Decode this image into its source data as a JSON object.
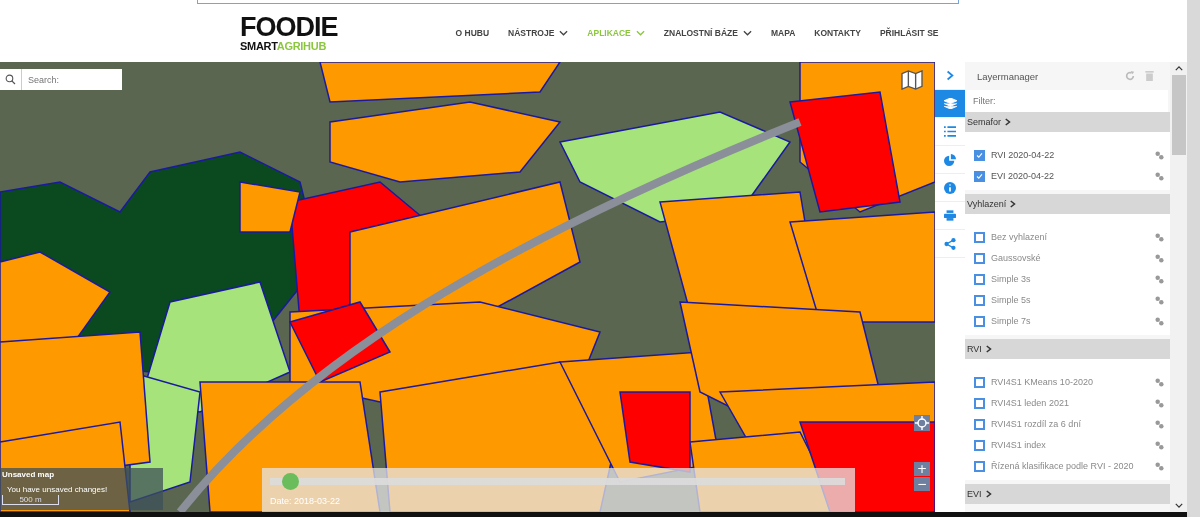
{
  "header": {
    "logo": {
      "word": "FOODIE",
      "sub_dark": "SMART",
      "sub_green": "AGRIHUB"
    },
    "nav": [
      {
        "label": "O HUBU",
        "selected": false,
        "dropdown": false
      },
      {
        "label": "NÁSTROJE",
        "selected": false,
        "dropdown": true
      },
      {
        "label": "APLIKACE",
        "selected": true,
        "dropdown": true
      },
      {
        "label": "ZNALOSTNÍ BÁZE",
        "selected": false,
        "dropdown": true
      },
      {
        "label": "MAPA",
        "selected": false,
        "dropdown": false
      },
      {
        "label": "KONTAKTY",
        "selected": false,
        "dropdown": false
      },
      {
        "label": "PŘIHLÁSIT SE",
        "selected": false,
        "dropdown": false
      }
    ]
  },
  "map": {
    "search": {
      "placeholder": "Search:"
    },
    "notice": {
      "title": "Unsaved map",
      "message": "You have unsaved changes!"
    },
    "scale": "500 m",
    "time_slider": {
      "level": 0.02,
      "label": "Date: 2018-03-22"
    },
    "zoom": [
      "+",
      "−"
    ]
  },
  "toolbar": [
    {
      "kind": "collapse",
      "selected": false
    },
    {
      "kind": "layers",
      "selected": true
    },
    {
      "kind": "legend",
      "selected": false
    },
    {
      "kind": "chart",
      "selected": false
    },
    {
      "kind": "info",
      "selected": false
    },
    {
      "kind": "print",
      "selected": false
    },
    {
      "kind": "share",
      "selected": false
    }
  ],
  "layer_manager": {
    "title": "Layermanager",
    "filter": {
      "placeholder": "Filter:"
    },
    "groups": [
      {
        "name": "Semafor",
        "layers": [
          {
            "name": "RVI 2020-04-22",
            "checked": true
          },
          {
            "name": "EVI 2020-04-22",
            "checked": true
          }
        ]
      },
      {
        "name": "Vyhlazení",
        "layers": [
          {
            "name": "Bez vyhlazení",
            "checked": false
          },
          {
            "name": "Gaussovské",
            "checked": false
          },
          {
            "name": "Simple 3s",
            "checked": false
          },
          {
            "name": "Simple 5s",
            "checked": false
          },
          {
            "name": "Simple 7s",
            "checked": false
          }
        ]
      },
      {
        "name": "RVI",
        "layers": [
          {
            "name": "RVI4S1 KMeans 10-2020",
            "checked": false
          },
          {
            "name": "RVI4S1 leden 2021",
            "checked": false
          },
          {
            "name": "RVI4S1 rozdíl za 6 dní",
            "checked": false
          },
          {
            "name": "RVI4S1 index",
            "checked": false
          },
          {
            "name": "Řízená klasifikace podle RVI - 2020",
            "checked": false
          }
        ]
      },
      {
        "name": "EVI"
      }
    ]
  }
}
